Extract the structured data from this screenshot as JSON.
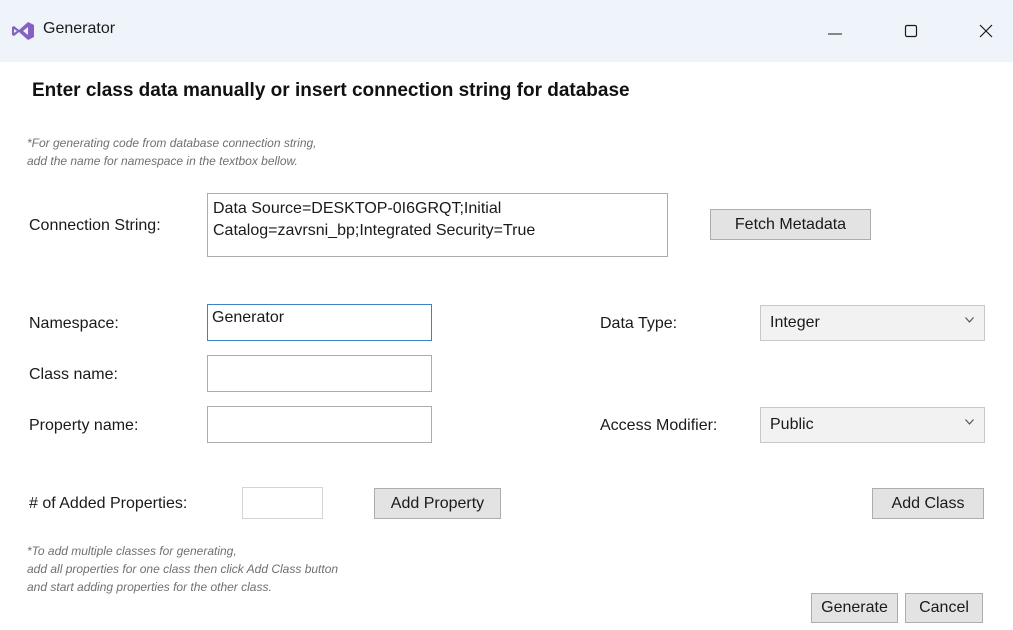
{
  "window": {
    "title": "Generator",
    "icon": "visual-studio-icon",
    "controls": [
      "minimize-icon",
      "maximize-icon",
      "close-icon"
    ]
  },
  "heading": "Enter class data manually or insert connection string for database",
  "db_note": {
    "line1": "*For generating code from database connection string,",
    "line2": "add the name for namespace in the textbox bellow."
  },
  "connection": {
    "label": "Connection String:",
    "value_line1": "Data Source=DESKTOP-0I6GRQT;Initial",
    "value_line2": "Catalog=zavrsni_bp;Integrated Security=True",
    "fetch_button": "Fetch Metadata"
  },
  "namespace": {
    "label": "Namespace:",
    "value": "Generator"
  },
  "class_name": {
    "label": "Class name:",
    "value": ""
  },
  "property_name": {
    "label": "Property name:",
    "value": ""
  },
  "data_type": {
    "label": "Data Type:",
    "selected": "Integer"
  },
  "access_modifier": {
    "label": "Access Modifier:",
    "selected": "Public"
  },
  "added_properties": {
    "label": "# of Added Properties:",
    "value": ""
  },
  "buttons": {
    "add_property": "Add Property",
    "add_class": "Add Class",
    "generate": "Generate",
    "cancel": "Cancel"
  },
  "classes_note": {
    "line1": "*To add multiple classes for generating,",
    "line2": "add all properties for one class then click Add Class button",
    "line3": "and start adding properties for the other class."
  },
  "colors": {
    "titlebar": "#eef4f9",
    "button_bg": "#e3e3e3",
    "focus_border": "#3c82c8",
    "note_text": "#707070",
    "vs_icon": "#8661c5"
  }
}
